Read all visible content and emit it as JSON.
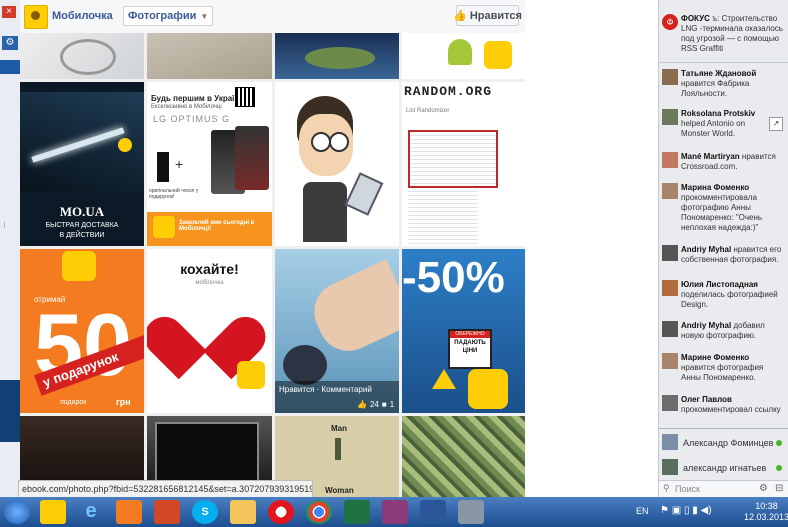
{
  "header": {
    "page_name": "Мобилочка",
    "section": "Фотографии",
    "like_label": "Нравится"
  },
  "tiles": {
    "mo_title": "MO.UA",
    "mo_sub1": "БЫСТРАЯ ДОСТАВКА",
    "mo_sub2": "В ДЕЙСТВИИ",
    "lg_head1": "Будь першим в Україні!",
    "lg_head2": "Ексклюзивно в Мобілочці",
    "lg_brand": "LG OPTIMUS G",
    "lg_gift": "оригінальний чохол у подарунок!",
    "lg_order": "Замовляй вже сьогодні в Мобілочці!",
    "random_title": "RANDOM.ORG",
    "random_sub": "List Randomizer",
    "fifty": "50",
    "fifty_top": "отримай",
    "fifty_ribbon": "у подарунок",
    "fifty_bottom": "подарок",
    "fifty_unit": "грн",
    "kohaite": "кохайте!",
    "kohaite_sub": "мобілочка",
    "photo_overlay": "Нравится · Комментарий",
    "photo_likes": "24",
    "photo_comments": "1",
    "percent": "-50%",
    "sign_top": "ОБЕРЕЖНО",
    "sign_mid": "ПАДАЮТЬ",
    "sign_bot": "ЦІНИ",
    "man_label": "Man",
    "woman_label": "Woman"
  },
  "sidebar": {
    "ticker": [
      {
        "name": "ФОКУС",
        "text": "ъ: Строительство LNG -терминала оказалось под угрозой — с помощью RSS Graffiti"
      },
      {
        "name": "Татьяне Ждановой",
        "text": "нравится Фабрика Лояльности."
      },
      {
        "name": "Roksolana Protskiv",
        "text": "helped Antonio on Monster World."
      },
      {
        "name": "Mané Martiryan",
        "text": "нравится Crossroad.com."
      },
      {
        "name": "Марина Фоменко",
        "text": "прокомментировала фотографию Анны Пономаренко: \"Очень неплохая надежда:)\""
      },
      {
        "name": "Andriy Myhal",
        "text": "нравится его собственная фотография."
      },
      {
        "name": "Юлия Листопадная",
        "text": "поделилась фотографией Design."
      },
      {
        "name": "Andriy Myhal",
        "text": "добавил новую фотографию."
      },
      {
        "name": "Марине Фоменко",
        "text": "нравится фотография Анны Пономаренко."
      },
      {
        "name": "Олег Павлов",
        "text": "прокомментировал ссылку"
      }
    ],
    "chat": [
      {
        "name": "Александр Фоминцев"
      },
      {
        "name": "александр игнатьев"
      }
    ],
    "search_placeholder": "Поиск"
  },
  "status_url": "ebook.com/photo.php?fbid=532281656812145&set=a.307207939319519.75807.2777306...",
  "taskbar": {
    "lang": "EN",
    "time": "10:38",
    "date": "12.03.2013"
  },
  "colors": {
    "fb_blue": "#3b5998",
    "taskbar": "#1c4d8f",
    "online": "#42b72a"
  }
}
